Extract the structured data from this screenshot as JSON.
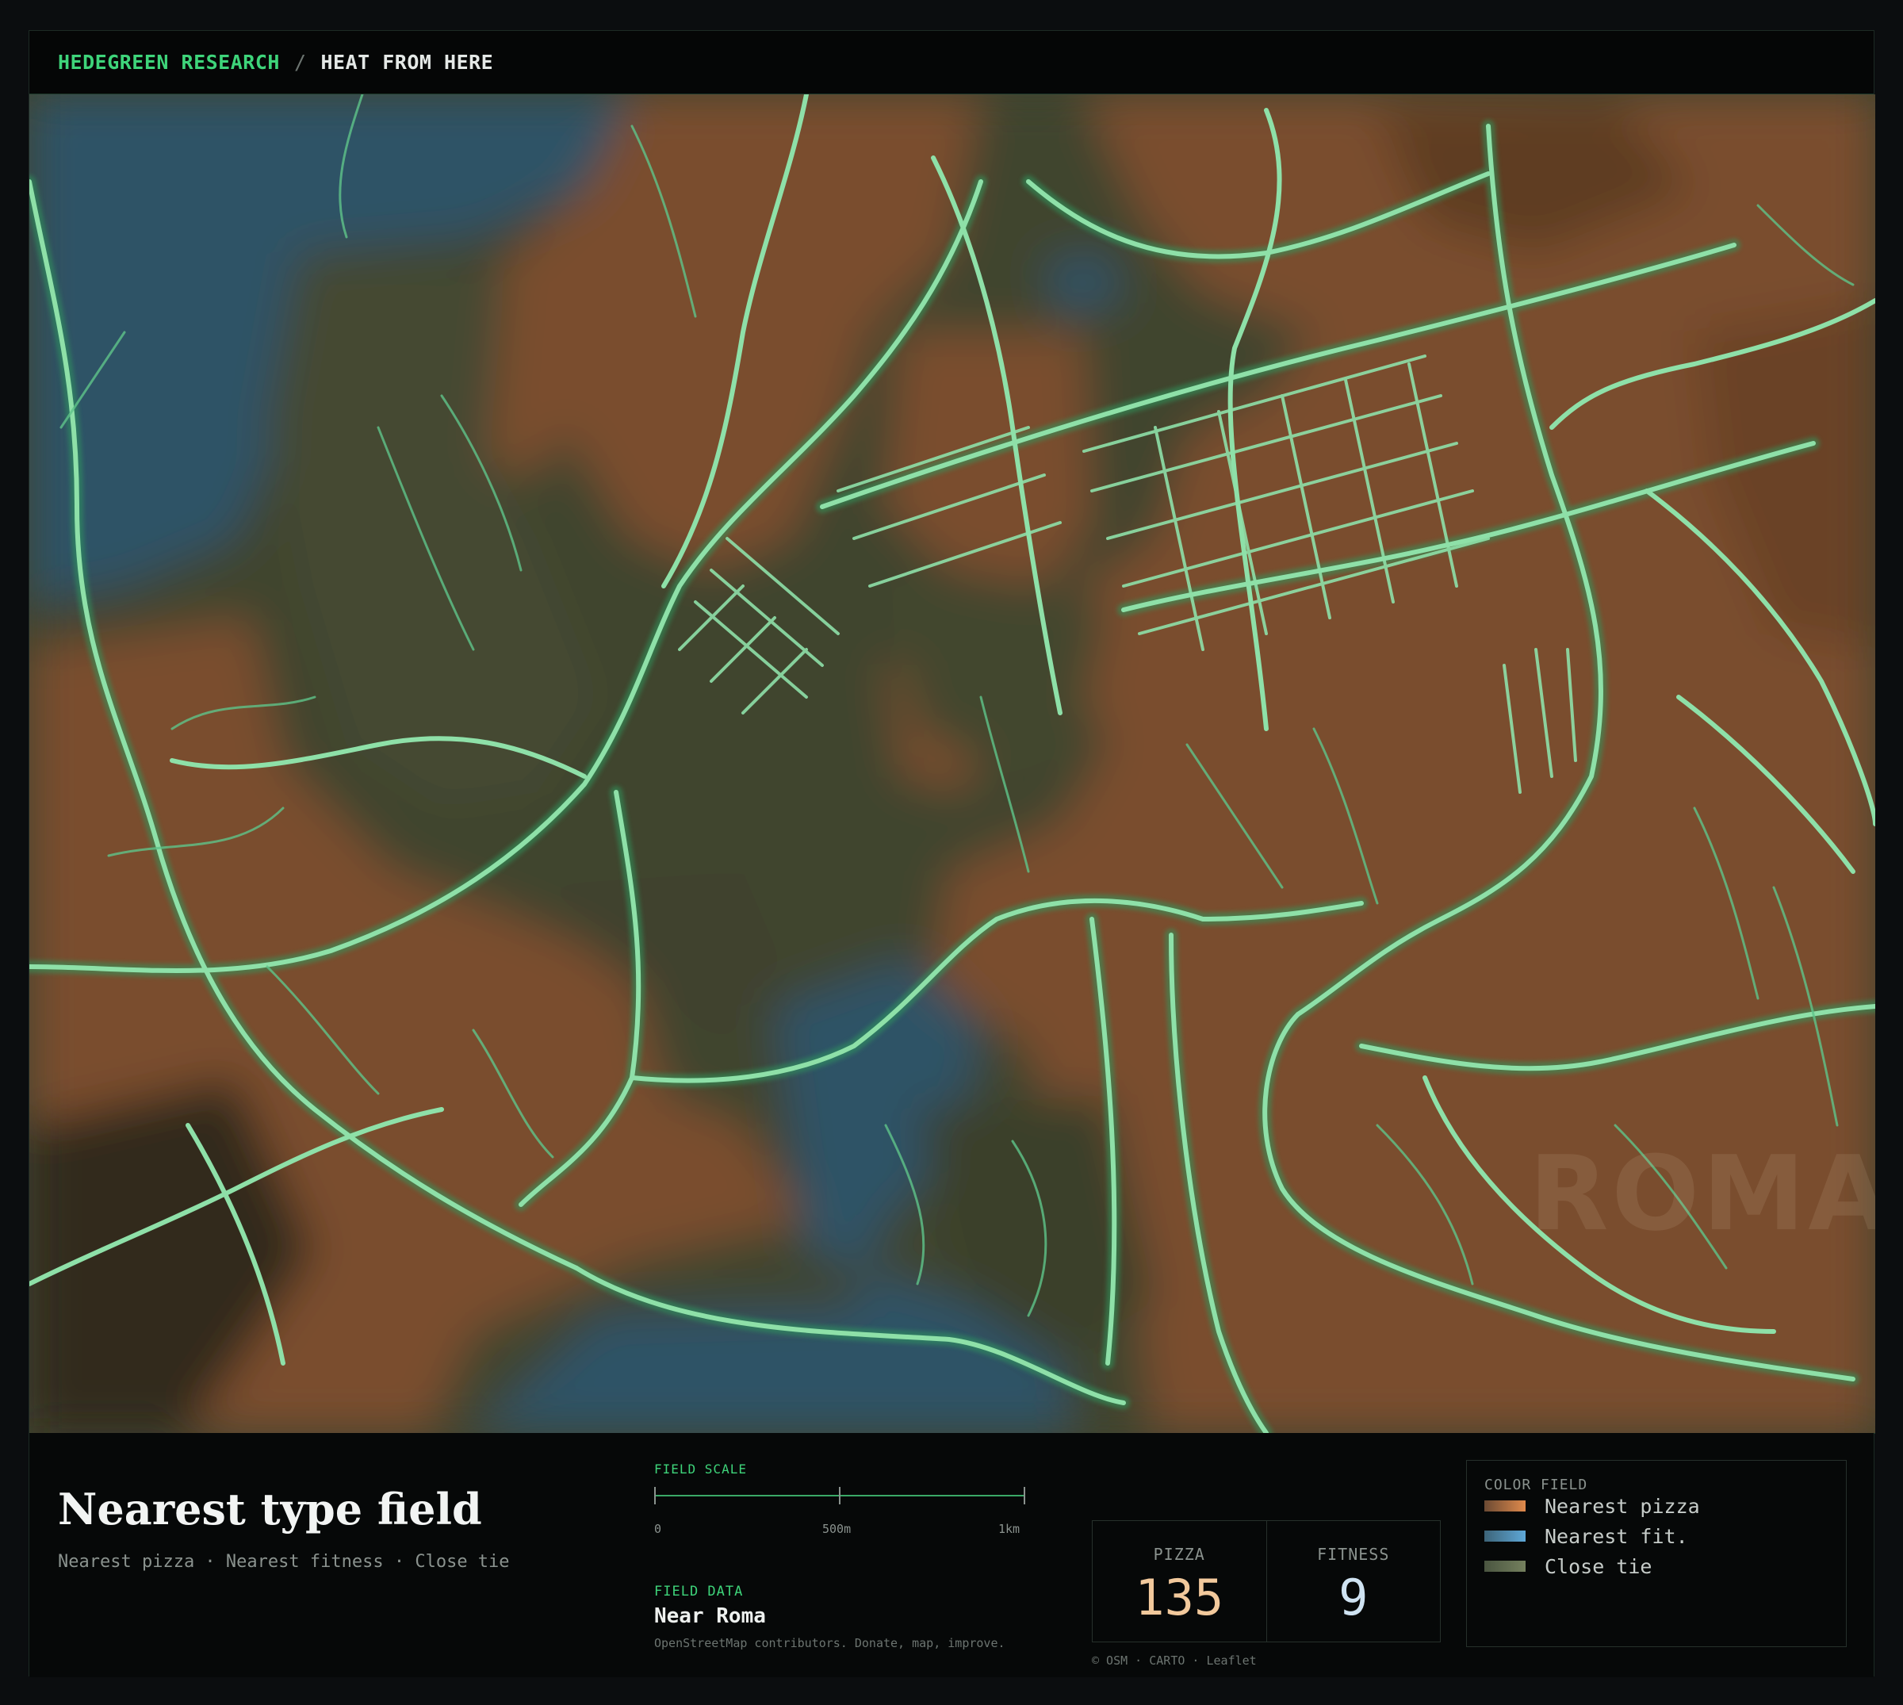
{
  "header": {
    "brand": "HEDEGREEN RESEARCH",
    "separator": "/",
    "section": "HEAT FROM HERE"
  },
  "map": {
    "watermark": "ROMA",
    "colors": {
      "pizza": "#7a4e2e",
      "fitness": "#2e5266",
      "tie": "#41452f",
      "road": "#8ee0a8",
      "road_glow": "#2f9a5e"
    }
  },
  "panel": {
    "title": "Nearest type field",
    "subtitle": "Nearest pizza · Nearest fitness · Close tie",
    "scale": {
      "label": "FIELD SCALE",
      "ticks": [
        "0",
        "500m",
        "1km"
      ]
    },
    "field_data": {
      "label": "FIELD DATA",
      "place": "Near Roma",
      "credit": "OpenStreetMap contributors. Donate, map, improve."
    },
    "stats": [
      {
        "label": "PIZZA",
        "value": "135",
        "color": "#f2c99c"
      },
      {
        "label": "FITNESS",
        "value": "9",
        "color": "#cfe3f2"
      }
    ],
    "attribution": "© OSM · CARTO · Leaflet",
    "legend": {
      "title": "COLOR FIELD",
      "items": [
        {
          "label": "Nearest pizza",
          "swatch": "#c77a45"
        },
        {
          "label": "Nearest fit.",
          "swatch": "#4d8fb8"
        },
        {
          "label": "Close tie",
          "swatch": "#5d6b4c"
        }
      ]
    }
  }
}
